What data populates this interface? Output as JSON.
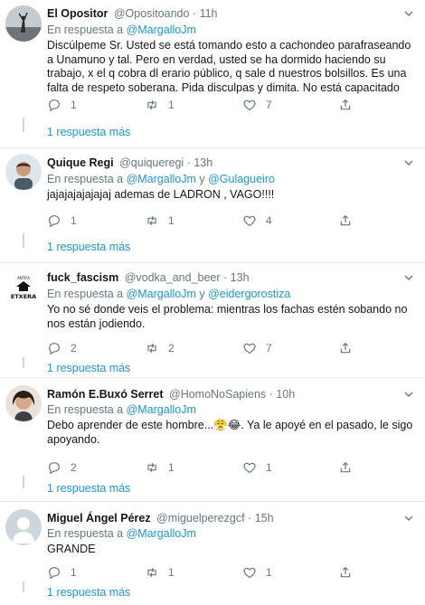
{
  "tweets": [
    {
      "name": "El Opositor",
      "handle": "@Opositoando",
      "time": "11h",
      "reply_prefix": "En respuesta a",
      "mentions": "@MargalloJm",
      "mention_join": "",
      "mention2": "",
      "text": "Discúlpeme Sr. Usted se está tomando esto a cachondeo parafraseando a Unamuno y tal. Pero en verdad, usted se ha dormido haciendo su trabajo, x el q cobra dl erario público, q sale d nuestros bolsillos. Es una falta de respeto soberana. Pida disculpas y dimita. No está capacitado",
      "replies": "1",
      "retweets": "1",
      "likes": "7",
      "more": "1 respuesta más"
    },
    {
      "name": "Quique Regi",
      "handle": "@quiqueregi",
      "time": "13h",
      "reply_prefix": "En respuesta a",
      "mentions": "@MargalloJm",
      "mention_join": "y",
      "mention2": "@Gulagueiro",
      "text": "jajajajajajajaj ademas de LADRON , VAGO!!!!",
      "replies": "1",
      "retweets": "1",
      "likes": "4",
      "more": "1 respuesta más"
    },
    {
      "name": "fuck_fascism",
      "handle": "@vodka_and_beer",
      "time": "13h",
      "reply_prefix": "En respuesta a",
      "mentions": "@MargalloJm",
      "mention_join": "y",
      "mention2": "@eidergorostiza",
      "text": "Yo no sé donde veis el problema: mientras los fachas estén sobando no nos están jodiendo.",
      "replies": "2",
      "retweets": "2",
      "likes": "7",
      "more": "1 respuesta más"
    },
    {
      "name": "Ramón E.Buxó Serret",
      "handle": "@HomoNoSapiens",
      "time": "10h",
      "reply_prefix": "En respuesta a",
      "mentions": "@MargalloJm",
      "mention_join": "",
      "mention2": "",
      "text": "Debo aprender de este hombre...😤😂. Ya le apoyé en el pasado, le sigo apoyando.",
      "replies": "2",
      "retweets": "1",
      "likes": "1",
      "more": "1 respuesta más"
    },
    {
      "name": "Miguel Ángel Pérez",
      "handle": "@miguelperezgcf",
      "time": "15h",
      "reply_prefix": "En respuesta a",
      "mentions": "@MargalloJm",
      "mention_join": "",
      "mention2": "",
      "text": "GRANDE",
      "replies": "1",
      "retweets": "1",
      "likes": "1",
      "more": "1 respuesta más"
    }
  ],
  "separator": "·",
  "avatar3_logo_text": "ETXERA",
  "icons": [
    "chevron-down-icon",
    "reply-icon",
    "retweet-icon",
    "like-icon",
    "share-icon"
  ],
  "colors": {
    "accent": "#1b95e0",
    "muted": "#657786",
    "border": "#e6ecf0"
  }
}
